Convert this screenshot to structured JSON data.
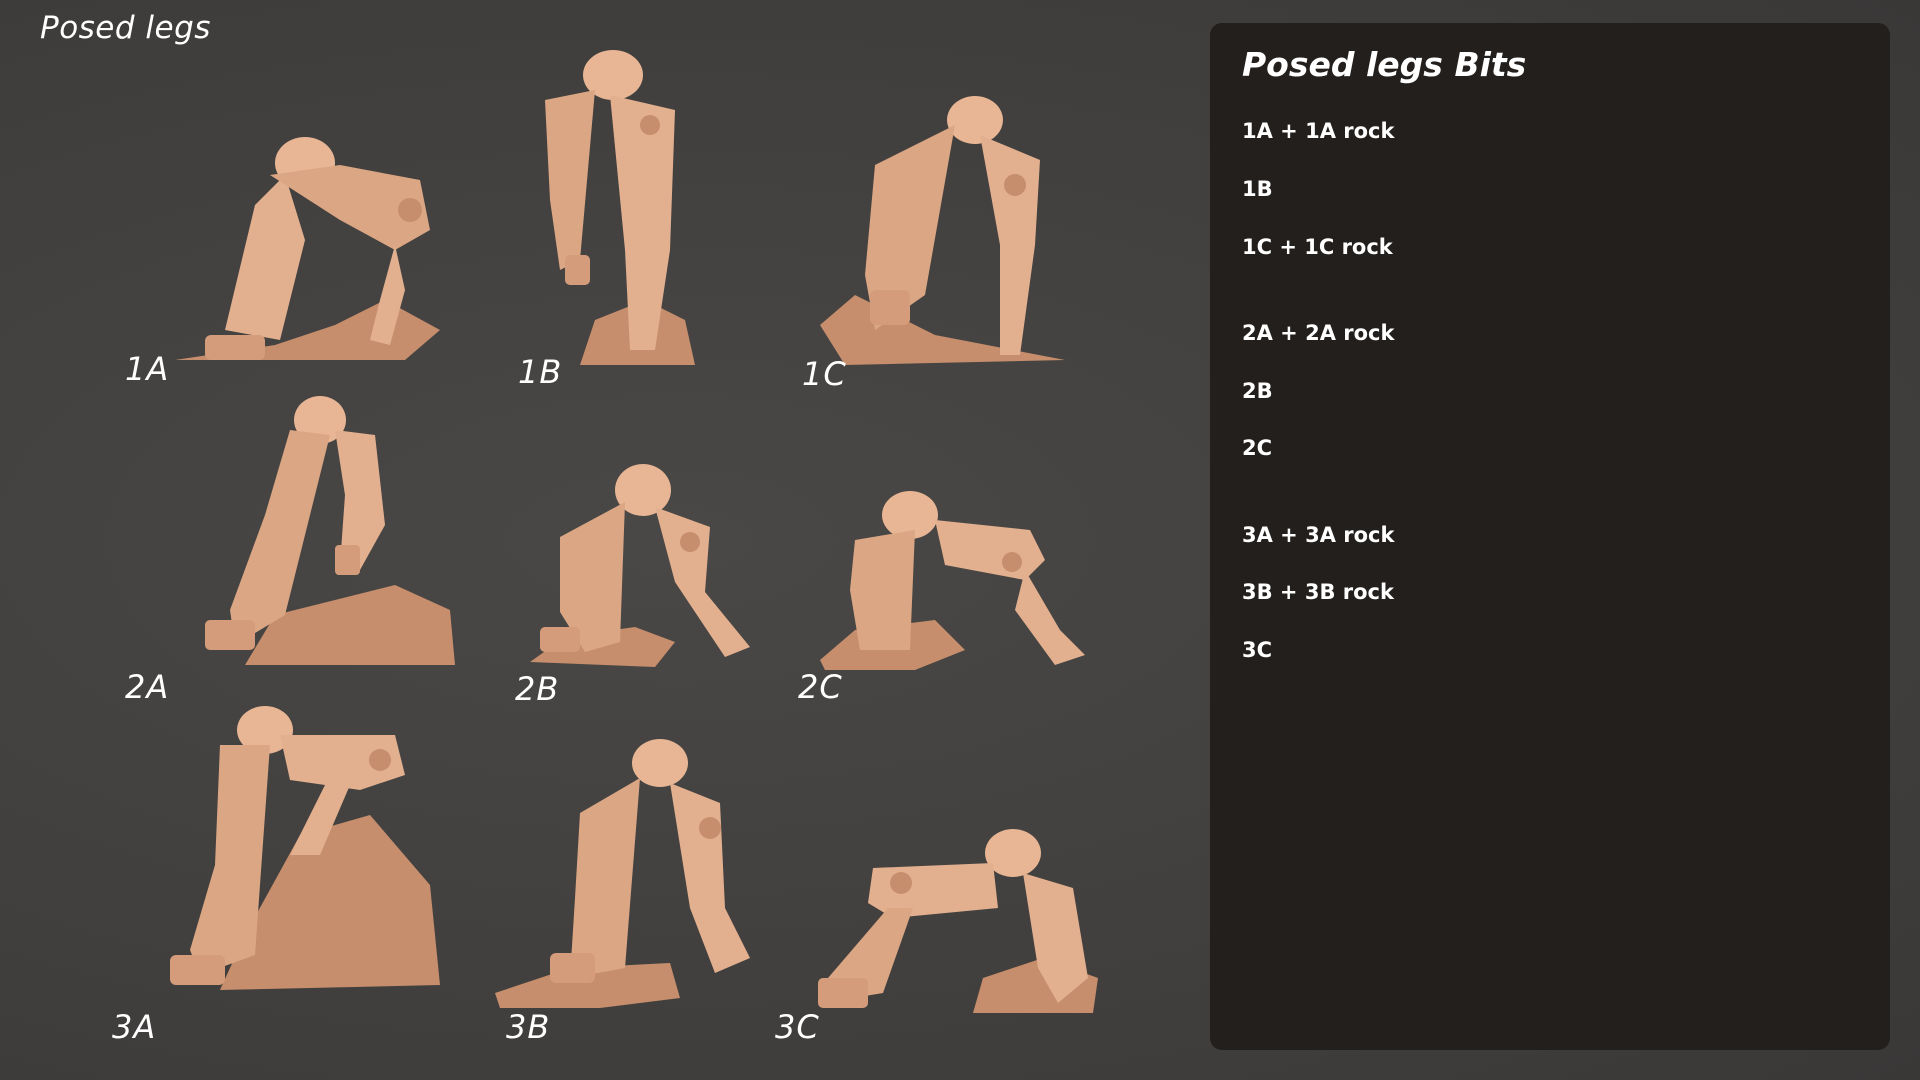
{
  "page": {
    "title": "Posed legs"
  },
  "grid": {
    "labels": [
      "1A",
      "1B",
      "1C",
      "2A",
      "2B",
      "2C",
      "3A",
      "3B",
      "3C"
    ]
  },
  "panel": {
    "title": "Posed legs Bits",
    "items": [
      "1A + 1A rock",
      "1B",
      "1C + 1C rock",
      "2A + 2A rock",
      "2B",
      "2C",
      "3A + 3A rock",
      "3B + 3B rock",
      "3C"
    ]
  },
  "colors": {
    "background": "#434140",
    "panel": "#221f1c",
    "model_fill": "#e3b08f",
    "model_shadow": "#c68e6c",
    "text": "#ffffff"
  }
}
